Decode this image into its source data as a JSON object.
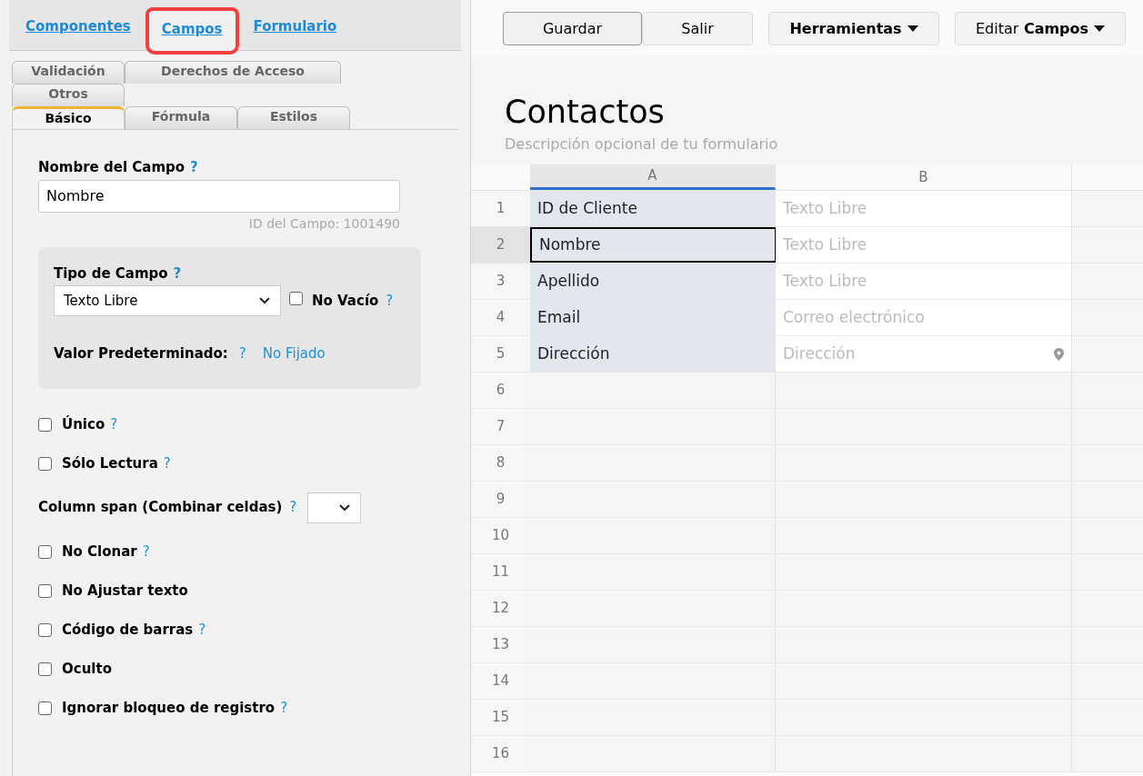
{
  "top_tabs": [
    {
      "label": "Componentes",
      "selected": false,
      "highlighted": false
    },
    {
      "label": "Campos",
      "selected": true,
      "highlighted": true
    },
    {
      "label": "Formulario",
      "selected": false,
      "highlighted": false
    }
  ],
  "sub_tab_rows": [
    [
      {
        "label": "Validación",
        "selected": false
      },
      {
        "label": "Derechos de Acceso",
        "selected": false
      }
    ],
    [
      {
        "label": "Otros",
        "selected": false
      }
    ],
    [
      {
        "label": "Básico",
        "selected": true
      },
      {
        "label": "Fórmula",
        "selected": false
      },
      {
        "label": "Estilos",
        "selected": false
      }
    ]
  ],
  "field_name": {
    "label": "Nombre del Campo",
    "help": "?",
    "value": "Nombre",
    "id_text": "ID del Campo: 1001490"
  },
  "field_type": {
    "label": "Tipo de Campo",
    "help": "?",
    "value": "Texto Libre",
    "required_label": "No Vacío",
    "required_help": "?",
    "required": false,
    "default_label": "Valor Predeterminado:",
    "default_help": "?",
    "default_value": "No Fijado"
  },
  "options": [
    {
      "kind": "checkbox",
      "label": "Único",
      "help": "?",
      "checked": false
    },
    {
      "kind": "checkbox",
      "label": "Sólo Lectura",
      "help": "?",
      "checked": false
    },
    {
      "kind": "select",
      "label": "Column span (Combinar celdas)",
      "help": "?"
    },
    {
      "kind": "checkbox",
      "label": "No Clonar",
      "help": "?",
      "checked": false
    },
    {
      "kind": "checkbox",
      "label": "No Ajustar texto",
      "checked": false
    },
    {
      "kind": "checkbox",
      "label": "Código de barras",
      "help": "?",
      "checked": false
    },
    {
      "kind": "checkbox",
      "label": "Oculto",
      "checked": false
    },
    {
      "kind": "checkbox",
      "label": "Ignorar bloqueo de registro",
      "help": "?",
      "checked": false
    }
  ],
  "toolbar": [
    {
      "kind": "plain",
      "parts": [
        {
          "text": "Guardar",
          "bold": false
        }
      ],
      "pressed": true
    },
    {
      "kind": "plain",
      "parts": [
        {
          "text": "Salir",
          "bold": false
        }
      ],
      "pressed": false
    },
    {
      "kind": "menu",
      "parts": [
        {
          "text": "Herramientas",
          "bold": true
        }
      ],
      "pressed": false
    },
    {
      "kind": "menu",
      "parts": [
        {
          "text": "Editar",
          "bold": false
        },
        {
          "text": "Campos",
          "bold": true
        }
      ],
      "pressed": false
    }
  ],
  "form": {
    "title": "Contactos",
    "description": "Descripción opcional de tu formulario"
  },
  "grid": {
    "columns": [
      {
        "label": "A",
        "selected": true
      },
      {
        "label": "B",
        "selected": false
      }
    ],
    "rows": [
      {
        "number": "1",
        "a": "ID de Cliente",
        "b": "Texto Libre",
        "pin": false,
        "selected": false
      },
      {
        "number": "2",
        "a": "Nombre",
        "b": "Texto Libre",
        "pin": false,
        "selected": true
      },
      {
        "number": "3",
        "a": "Apellido",
        "b": "Texto Libre",
        "pin": false,
        "selected": false
      },
      {
        "number": "4",
        "a": "Email",
        "b": "Correo electrónico",
        "pin": false,
        "selected": false
      },
      {
        "number": "5",
        "a": "Dirección",
        "b": "Dirección",
        "pin": true,
        "selected": false
      },
      {
        "number": "6"
      },
      {
        "number": "7"
      },
      {
        "number": "8"
      },
      {
        "number": "9"
      },
      {
        "number": "10"
      },
      {
        "number": "11"
      },
      {
        "number": "12"
      },
      {
        "number": "13"
      },
      {
        "number": "14"
      },
      {
        "number": "15"
      },
      {
        "number": "16"
      }
    ]
  }
}
